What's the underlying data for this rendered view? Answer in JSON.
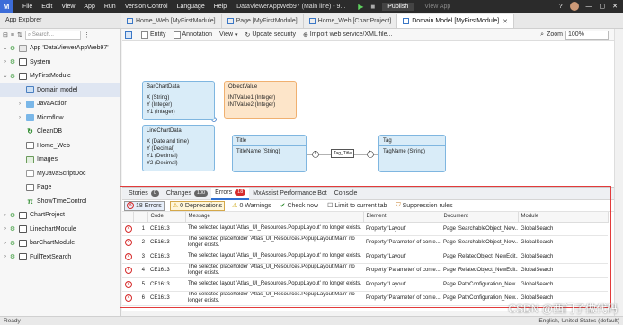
{
  "titlebar": {
    "logo": "M",
    "menu": [
      "File",
      "Edit",
      "View",
      "App",
      "Run",
      "Version Control",
      "Language",
      "Help"
    ],
    "app_title": "DataViewerAppWeb97 (Main line) - 9...",
    "publish": "Publish",
    "view_app": "View App"
  },
  "explorer_title": "App Explorer",
  "tabs": [
    {
      "label": "Home_Web [MyFirstModule]"
    },
    {
      "label": "Page [MyFirstModule]"
    },
    {
      "label": "Home_Web [ChartProject]"
    },
    {
      "label": "Domain Model [MyFirstModule]"
    }
  ],
  "sidebar": {
    "search_placeholder": "Search...",
    "items": [
      {
        "label": "App 'DataViewerAppWeb97'"
      },
      {
        "label": "System"
      },
      {
        "label": "MyFirstModule"
      },
      {
        "label": "Domain model"
      },
      {
        "label": "JavaAction"
      },
      {
        "label": "Microflow"
      },
      {
        "label": "CleanDB"
      },
      {
        "label": "Home_Web"
      },
      {
        "label": "Images"
      },
      {
        "label": "MyJavaScriptDoc"
      },
      {
        "label": "Page"
      },
      {
        "label": "ShowTimeControl"
      },
      {
        "label": "ChartProject"
      },
      {
        "label": "LinechartModule"
      },
      {
        "label": "barChartModule"
      },
      {
        "label": "FullTextSearch"
      }
    ]
  },
  "toolbar": {
    "entity": "Entity",
    "annotation": "Annotation",
    "view": "View",
    "update_security": "Update security",
    "import": "Import web service/XML file...",
    "zoom_label": "Zoom",
    "zoom_value": "100%"
  },
  "entities": {
    "barchart": {
      "title": "BarChartData",
      "attrs": [
        "X (String)",
        "Y (Integer)",
        "Y1 (Integer)"
      ]
    },
    "objectvalue": {
      "title": "ObjectValue",
      "attrs": [
        "INTValue1 (Integer)",
        "INTValue2 (Integer)"
      ]
    },
    "linechart": {
      "title": "LineChartData",
      "attrs": [
        "X (Date and time)",
        "Y (Decimal)",
        "Y1 (Decimal)",
        "Y2 (Decimal)"
      ]
    },
    "title": {
      "title": "Title",
      "attrs": [
        "TitleName (String)"
      ]
    },
    "tag": {
      "title": "Tag",
      "attrs": [
        "TagName (String)"
      ]
    },
    "assoc_label": "Tag_Title",
    "assoc_left_mult": "1",
    "assoc_right_mult": "*"
  },
  "panel": {
    "tabs": [
      {
        "label": "Stories",
        "count": "0"
      },
      {
        "label": "Changes",
        "count": "100"
      },
      {
        "label": "Errors",
        "count": "18"
      },
      {
        "label": "MxAssist Performance Bot",
        "count": ""
      },
      {
        "label": "Console",
        "count": ""
      }
    ],
    "tools": {
      "errors": "18 Errors",
      "deprecations": "0 Deprecations",
      "warnings": "0 Warnings",
      "check_now": "Check now",
      "limit": "Limit to current tab",
      "suppression": "Suppression rules"
    },
    "columns": [
      "Code",
      "Message",
      "Element",
      "Document",
      "Module"
    ],
    "rows": [
      {
        "num": "1",
        "code": "CE1613",
        "message": "The selected layout 'Atlas_UI_Resources.PopupLayout' no longer exists.",
        "element": "Property 'Layout'",
        "document": "Page 'SearchableObject_New...",
        "module": "GlobalSearch"
      },
      {
        "num": "2",
        "code": "CE1613",
        "message": "The selected placeholder 'Atlas_UI_Resources.PopupLayout.Main' no longer exists.",
        "element": "Property 'Parameter' of conte...",
        "document": "Page 'SearchableObject_New...",
        "module": "GlobalSearch"
      },
      {
        "num": "3",
        "code": "CE1613",
        "message": "The selected layout 'Atlas_UI_Resources.PopupLayout' no longer exists.",
        "element": "Property 'Layout'",
        "document": "Page 'RelatedObject_NewEdit...",
        "module": "GlobalSearch"
      },
      {
        "num": "4",
        "code": "CE1613",
        "message": "The selected placeholder 'Atlas_UI_Resources.PopupLayout.Main' no longer exists.",
        "element": "Property 'Parameter' of conte...",
        "document": "Page 'RelatedObject_NewEdit...",
        "module": "GlobalSearch"
      },
      {
        "num": "5",
        "code": "CE1613",
        "message": "The selected layout 'Atlas_UI_Resources.PopupLayout' no longer exists.",
        "element": "Property 'Layout'",
        "document": "Page 'PathConfiguration_New...",
        "module": "GlobalSearch"
      },
      {
        "num": "6",
        "code": "CE1613",
        "message": "The selected placeholder 'Atlas_UI_Resources.PopupLayout.Main' no longer exists.",
        "element": "Property 'Parameter' of conte...",
        "document": "Page 'PathConfiguration_New...",
        "module": "GlobalSearch"
      }
    ]
  },
  "status": {
    "left": "Ready",
    "right": "English, United States (default)"
  },
  "watermark": "CSDN @西门子做代码",
  "colors": {
    "accent": "#2f6fd0",
    "error": "#d52b2b",
    "entity_blue": "#d9ecf8",
    "entity_orange": "#fde5c9"
  }
}
